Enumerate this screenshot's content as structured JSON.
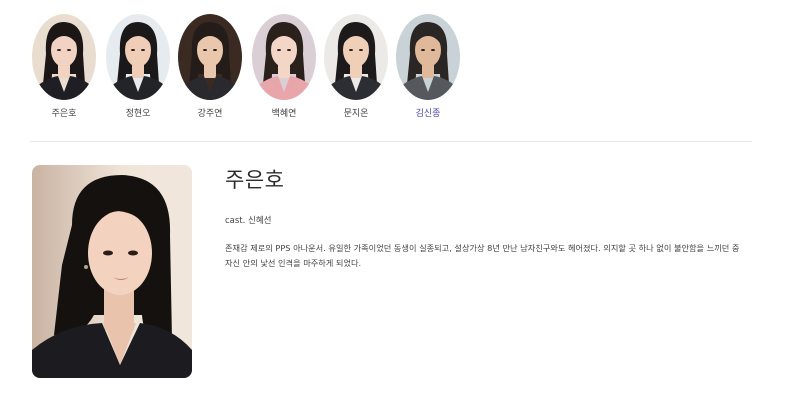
{
  "cast_list": [
    {
      "name": "주은호",
      "skin": "#f2d3c2",
      "hair": "#1c1616",
      "bg": "#e9ddd0",
      "outfit": "#1e1e24",
      "active": false
    },
    {
      "name": "정현오",
      "skin": "#efcdb7",
      "hair": "#1a1818",
      "bg": "#e6ebef",
      "outfit": "#232428",
      "active": false
    },
    {
      "name": "강주연",
      "skin": "#e9c7ad",
      "hair": "#231c18",
      "bg": "#3a2a22",
      "outfit": "#2a2a2e",
      "active": false
    },
    {
      "name": "백혜연",
      "skin": "#f3d6c6",
      "hair": "#2a201c",
      "bg": "#d9cfd4",
      "outfit": "#e9a6aa",
      "active": false
    },
    {
      "name": "문지온",
      "skin": "#efcfb8",
      "hair": "#1c1a1a",
      "bg": "#eceae7",
      "outfit": "#2d2e33",
      "active": false
    },
    {
      "name": "김신종",
      "skin": "#e0b89a",
      "hair": "#2a2624",
      "bg": "#c9d2d6",
      "outfit": "#55585d",
      "active": true
    }
  ],
  "detail": {
    "name": "주은호",
    "cast": "cast. 신혜선",
    "description": "존재감 제로의 PPS 아나운서. 유일한 가족이었던 동생이 실종되고, 설상가상 8년 만난 남자친구와도 헤어졌다. 의지할 곳 하나 없이 불안함을 느끼던 중 자신 안의 낯선 인격을 마주하게 되었다."
  },
  "colors": {
    "active_name": "#4a4aa8",
    "divider": "#e6e6e6"
  }
}
